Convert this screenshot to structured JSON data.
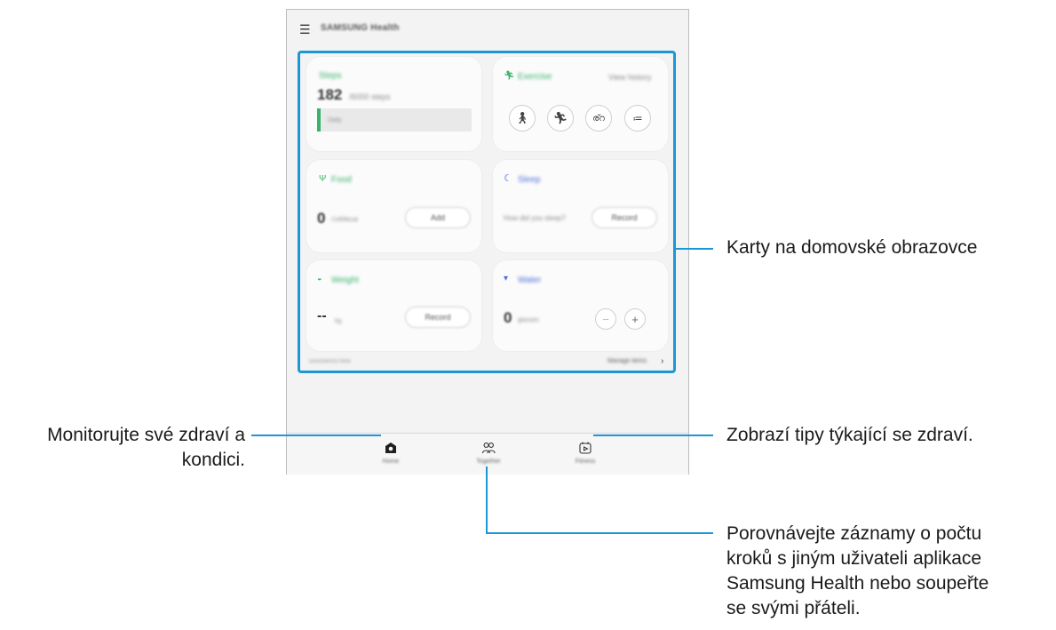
{
  "app": {
    "title": "SAMSUNG Health",
    "menu_icon": "hamburger-menu-icon"
  },
  "cards": {
    "steps": {
      "title": "Steps",
      "value": "182",
      "unit": "/6000 steps",
      "bar_label": "Daily"
    },
    "exercise": {
      "title": "Exercise",
      "link": "View history",
      "buttons": [
        "walk-icon",
        "run-icon",
        "bike-icon",
        "list-icon"
      ]
    },
    "food": {
      "title": "Food",
      "value": "0",
      "unit": "/1466kcal",
      "button": "Add"
    },
    "sleep": {
      "title": "Sleep",
      "prompt": "How did you sleep?",
      "button": "Record"
    },
    "weight": {
      "title": "Weight",
      "value": "--",
      "unit": "kg",
      "button": "Record"
    },
    "water": {
      "title": "Water",
      "value": "0",
      "unit": "glasses",
      "minus": "−",
      "plus": "+"
    }
  },
  "footer": {
    "left": "Discover/Go Now",
    "right": "Manage items",
    "chevron": "›"
  },
  "nav": [
    {
      "label": "Home",
      "icon": "home-icon"
    },
    {
      "label": "Together",
      "icon": "people-icon"
    },
    {
      "label": "Fitness",
      "icon": "calendar-play-icon"
    }
  ],
  "callouts": {
    "home_cards": "Karty na domovské obrazovce",
    "monitor_line1": "Monitorujte své zdraví a",
    "monitor_line2": "kondici.",
    "tips": "Zobrazí tipy týkající se zdraví.",
    "compare_line1": "Porovnávejte záznamy o počtu",
    "compare_line2": "kroků s jiným uživateli aplikace",
    "compare_line3": "Samsung Health nebo soupeřte",
    "compare_line4": "se svými přáteli."
  },
  "colors": {
    "accent_line": "#1c97d6",
    "green": "#38b36a",
    "blue": "#4f6fd8"
  }
}
